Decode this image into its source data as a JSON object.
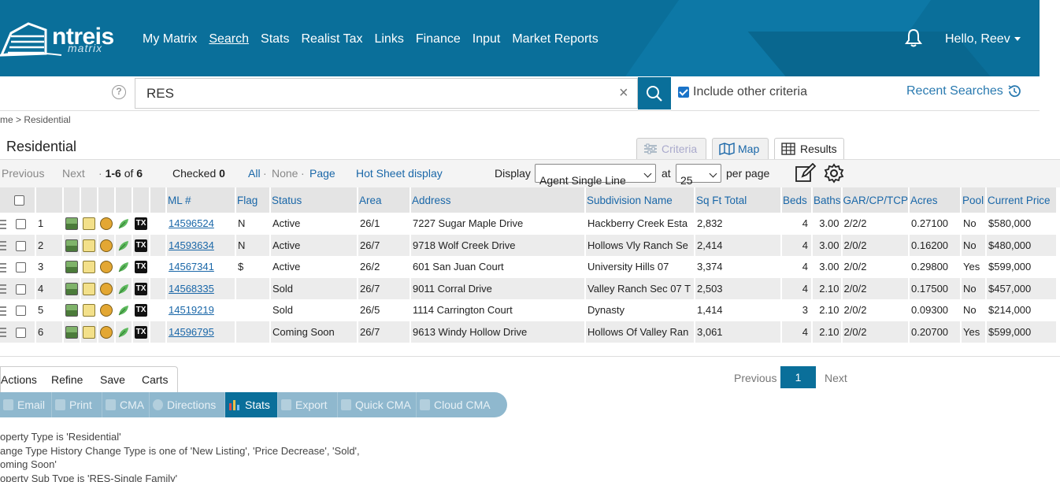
{
  "header": {
    "logo_word": "ntreis",
    "logo_sub": "matrix",
    "nav": [
      "My Matrix",
      "Search",
      "Stats",
      "Realist Tax",
      "Links",
      "Finance",
      "Input",
      "Market Reports"
    ],
    "active_nav": "Search",
    "greeting": "Hello, Reev"
  },
  "search": {
    "value": "RES",
    "include_other_label": "Include other criteria",
    "include_other_checked": true,
    "recent_label": "Recent Searches"
  },
  "breadcrumb": "me > Residential",
  "page_title": "Residential",
  "tabs": {
    "criteria": "Criteria",
    "map": "Map",
    "results": "Results"
  },
  "toolbar": {
    "previous": "Previous",
    "next": "Next",
    "range": "1-6",
    "of": "of",
    "total": "6",
    "checked_label": "Checked",
    "checked_count": "0",
    "all": "All",
    "none": "None",
    "page": "Page",
    "hot_sheet": "Hot Sheet display",
    "display_label": "Display",
    "display_value": "Agent Single Line",
    "at_label": "at",
    "per_page_value": "25",
    "per_page_label": "per page"
  },
  "table": {
    "columns": [
      "ML #",
      "Flag",
      "Status",
      "Area",
      "Address",
      "Subdivision Name",
      "Sq Ft Total",
      "Beds",
      "Baths",
      "GAR/CP/TCP",
      "Acres",
      "Pool",
      "Current Price"
    ],
    "rows": [
      {
        "n": "1",
        "ml": "14596524",
        "flag": "N",
        "status": "Active",
        "area": "26/1",
        "address": "7227 Sugar Maple Drive",
        "subdivision": "Hackberry Creek Esta",
        "sqft": "2,832",
        "beds": "4",
        "baths": "3.00",
        "gar": "2/2/2",
        "acres": "0.27100",
        "pool": "No",
        "price": "$580,000"
      },
      {
        "n": "2",
        "ml": "14593634",
        "flag": "N",
        "status": "Active",
        "area": "26/7",
        "address": "9718 Wolf Creek Drive",
        "subdivision": "Hollows Vly Ranch Se",
        "sqft": "2,414",
        "beds": "4",
        "baths": "3.00",
        "gar": "2/0/2",
        "acres": "0.16200",
        "pool": "No",
        "price": "$480,000"
      },
      {
        "n": "3",
        "ml": "14567341",
        "flag": "$",
        "status": "Active",
        "area": "26/2",
        "address": "601 San Juan Court",
        "subdivision": "University Hills 07",
        "sqft": "3,374",
        "beds": "4",
        "baths": "3.00",
        "gar": "2/0/2",
        "acres": "0.29800",
        "pool": "Yes",
        "price": "$599,000"
      },
      {
        "n": "4",
        "ml": "14568335",
        "flag": "",
        "status": "Sold",
        "area": "26/7",
        "address": "9011 Corral Drive",
        "subdivision": "Valley Ranch Sec 07 T",
        "sqft": "2,503",
        "beds": "4",
        "baths": "2.10",
        "gar": "2/0/2",
        "acres": "0.17500",
        "pool": "No",
        "price": "$457,000"
      },
      {
        "n": "5",
        "ml": "14519219",
        "flag": "",
        "status": "Sold",
        "area": "26/5",
        "address": "1114 Carrington Court",
        "subdivision": "Dynasty",
        "sqft": "1,414",
        "beds": "3",
        "baths": "2.10",
        "gar": "2/0/2",
        "acres": "0.09300",
        "pool": "No",
        "price": "$214,000"
      },
      {
        "n": "6",
        "ml": "14596795",
        "flag": "",
        "status": "Coming Soon",
        "area": "26/7",
        "address": "9613 Windy Hollow Drive",
        "subdivision": "Hollows Of Valley Ran",
        "sqft": "3,061",
        "beds": "4",
        "baths": "2.10",
        "gar": "2/0/2",
        "acres": "0.20700",
        "pool": "Yes",
        "price": "$599,000"
      }
    ],
    "tx_label": "TX"
  },
  "action_tabs": [
    "Actions",
    "Refine",
    "Save",
    "Carts"
  ],
  "actions": [
    "Email",
    "Print",
    "CMA",
    "Directions",
    "Stats",
    "Export",
    "Quick CMA",
    "Cloud CMA"
  ],
  "active_action": "Stats",
  "pager": {
    "previous": "Previous",
    "current": "1",
    "next": "Next"
  },
  "criteria_lines": [
    "operty Type is 'Residential'",
    "ange Type History Change Type is one of 'New Listing', 'Price Decrease', 'Sold',",
    "oming Soon'",
    "operty Sub Type is 'RES-Single Family'"
  ],
  "colors": {
    "brand": "#0a6f9a",
    "link": "#1a67a8",
    "action_bar": "#8fb8ce"
  }
}
